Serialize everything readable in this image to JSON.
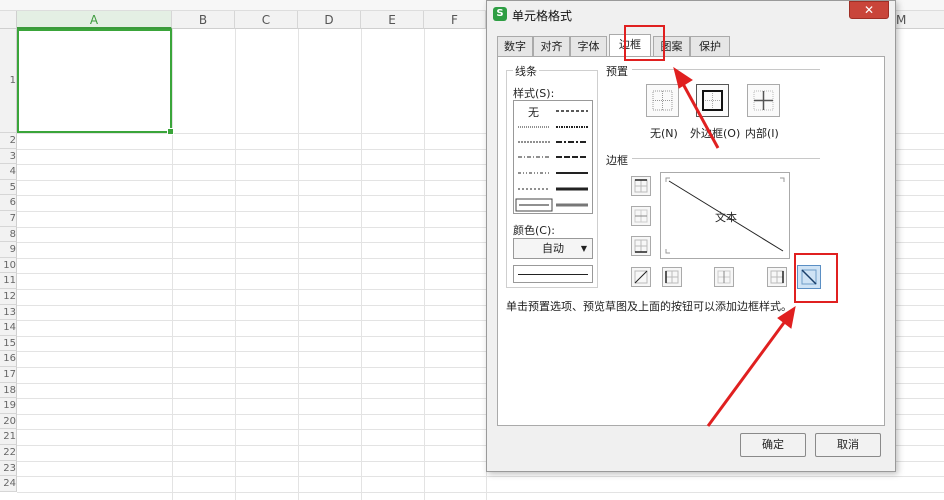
{
  "sheet": {
    "columns": [
      "A",
      "B",
      "C",
      "D",
      "E",
      "F"
    ],
    "extra_column": "M",
    "rows": [
      "1",
      "2",
      "3",
      "4",
      "5",
      "6",
      "7",
      "8",
      "9",
      "10",
      "11",
      "12",
      "13",
      "14",
      "15",
      "16",
      "17",
      "18",
      "19",
      "20",
      "21",
      "22",
      "23",
      "24"
    ]
  },
  "dialog": {
    "app_icon": "S",
    "title": "单元格格式",
    "close": "✕",
    "tabs": [
      "数字",
      "对齐",
      "字体",
      "边框",
      "图案",
      "保护"
    ],
    "active_tab": "边框",
    "line_group": "线条",
    "style_label": "样式(S):",
    "style_none": "无",
    "color_label": "颜色(C):",
    "color_value": "自动",
    "preset_group": "预置",
    "preset_none": "无(N)",
    "preset_outline": "外边框(O)",
    "preset_inside": "内部(I)",
    "border_group": "边框",
    "preview_text": "文本",
    "hint": "单击预置选项、预览草图及上面的按钮可以添加边框样式。",
    "ok": "确定",
    "cancel": "取消"
  },
  "colors": {
    "selection": "#3aa53a",
    "highlight": "#e02020"
  }
}
